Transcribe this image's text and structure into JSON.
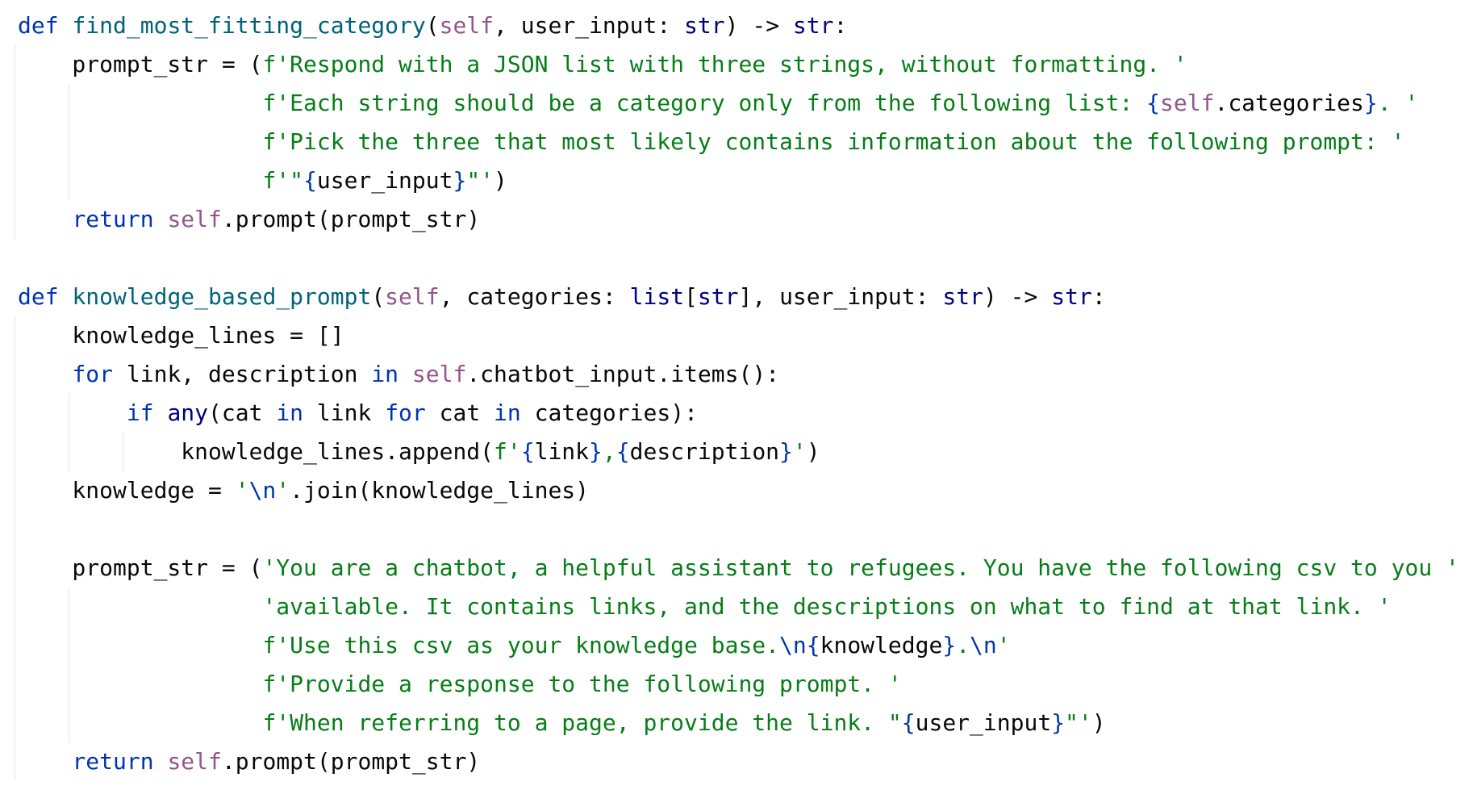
{
  "editor": {
    "colors": {
      "background": "#ffffff",
      "keyword": "#0033b3",
      "function_name": "#00627a",
      "self": "#94558d",
      "builtin": "#000080",
      "string": "#067d17",
      "fstring_brace": "#0037a6",
      "text": "#080808",
      "indent_guide": "#e6e6e6"
    },
    "lines": [
      {
        "tokens": [
          {
            "t": "def",
            "c": "kw"
          },
          {
            "t": " ",
            "c": "plain"
          },
          {
            "t": "find_most_fitting_category",
            "c": "fn"
          },
          {
            "t": "(",
            "c": "plain"
          },
          {
            "t": "self",
            "c": "self"
          },
          {
            "t": ", user_input: ",
            "c": "plain"
          },
          {
            "t": "str",
            "c": "builtin"
          },
          {
            "t": ") -> ",
            "c": "plain"
          },
          {
            "t": "str",
            "c": "builtin"
          },
          {
            "t": ":",
            "c": "plain"
          }
        ]
      },
      {
        "tokens": [
          {
            "t": "    prompt_str = (",
            "c": "plain"
          },
          {
            "t": "f'Respond with a JSON list with three strings, without formatting. '",
            "c": "str"
          }
        ]
      },
      {
        "tokens": [
          {
            "t": "                  ",
            "c": "plain"
          },
          {
            "t": "f'Each string should be a category only from the following list: ",
            "c": "str"
          },
          {
            "t": "{",
            "c": "brace"
          },
          {
            "t": "self",
            "c": "self"
          },
          {
            "t": ".categories",
            "c": "plain"
          },
          {
            "t": "}",
            "c": "brace"
          },
          {
            "t": ". '",
            "c": "str"
          }
        ]
      },
      {
        "tokens": [
          {
            "t": "                  ",
            "c": "plain"
          },
          {
            "t": "f'Pick the three that most likely contains information about the following prompt: '",
            "c": "str"
          }
        ]
      },
      {
        "tokens": [
          {
            "t": "                  ",
            "c": "plain"
          },
          {
            "t": "f'\"",
            "c": "str"
          },
          {
            "t": "{",
            "c": "brace"
          },
          {
            "t": "user_input",
            "c": "plain"
          },
          {
            "t": "}",
            "c": "brace"
          },
          {
            "t": "\"'",
            "c": "str"
          },
          {
            "t": ")",
            "c": "plain"
          }
        ]
      },
      {
        "tokens": [
          {
            "t": "    ",
            "c": "plain"
          },
          {
            "t": "return",
            "c": "kw"
          },
          {
            "t": " ",
            "c": "plain"
          },
          {
            "t": "self",
            "c": "self"
          },
          {
            "t": ".prompt(prompt_str)",
            "c": "plain"
          }
        ]
      },
      {
        "tokens": []
      },
      {
        "tokens": [
          {
            "t": "def",
            "c": "kw"
          },
          {
            "t": " ",
            "c": "plain"
          },
          {
            "t": "knowledge_based_prompt",
            "c": "fn"
          },
          {
            "t": "(",
            "c": "plain"
          },
          {
            "t": "self",
            "c": "self"
          },
          {
            "t": ", categories: ",
            "c": "plain"
          },
          {
            "t": "list",
            "c": "builtin"
          },
          {
            "t": "[",
            "c": "plain"
          },
          {
            "t": "str",
            "c": "builtin"
          },
          {
            "t": "], user_input: ",
            "c": "plain"
          },
          {
            "t": "str",
            "c": "builtin"
          },
          {
            "t": ") -> ",
            "c": "plain"
          },
          {
            "t": "str",
            "c": "builtin"
          },
          {
            "t": ":",
            "c": "plain"
          }
        ]
      },
      {
        "tokens": [
          {
            "t": "    knowledge_lines = []",
            "c": "plain"
          }
        ]
      },
      {
        "tokens": [
          {
            "t": "    ",
            "c": "plain"
          },
          {
            "t": "for",
            "c": "kw"
          },
          {
            "t": " link, description ",
            "c": "plain"
          },
          {
            "t": "in",
            "c": "kw"
          },
          {
            "t": " ",
            "c": "plain"
          },
          {
            "t": "self",
            "c": "self"
          },
          {
            "t": ".chatbot_input.items():",
            "c": "plain"
          }
        ]
      },
      {
        "tokens": [
          {
            "t": "        ",
            "c": "plain"
          },
          {
            "t": "if",
            "c": "kw"
          },
          {
            "t": " ",
            "c": "plain"
          },
          {
            "t": "any",
            "c": "builtin"
          },
          {
            "t": "(cat ",
            "c": "plain"
          },
          {
            "t": "in",
            "c": "kw"
          },
          {
            "t": " link ",
            "c": "plain"
          },
          {
            "t": "for",
            "c": "kw"
          },
          {
            "t": " cat ",
            "c": "plain"
          },
          {
            "t": "in",
            "c": "kw"
          },
          {
            "t": " categories):",
            "c": "plain"
          }
        ]
      },
      {
        "tokens": [
          {
            "t": "            knowledge_lines.append(",
            "c": "plain"
          },
          {
            "t": "f'",
            "c": "str"
          },
          {
            "t": "{",
            "c": "brace"
          },
          {
            "t": "link",
            "c": "plain"
          },
          {
            "t": "}",
            "c": "brace"
          },
          {
            "t": ",",
            "c": "str"
          },
          {
            "t": "{",
            "c": "brace"
          },
          {
            "t": "description",
            "c": "plain"
          },
          {
            "t": "}",
            "c": "brace"
          },
          {
            "t": "'",
            "c": "str"
          },
          {
            "t": ")",
            "c": "plain"
          }
        ]
      },
      {
        "tokens": [
          {
            "t": "    knowledge = ",
            "c": "plain"
          },
          {
            "t": "'",
            "c": "str"
          },
          {
            "t": "\\n",
            "c": "brace"
          },
          {
            "t": "'",
            "c": "str"
          },
          {
            "t": ".join(knowledge_lines)",
            "c": "plain"
          }
        ]
      },
      {
        "tokens": []
      },
      {
        "tokens": [
          {
            "t": "    prompt_str = (",
            "c": "plain"
          },
          {
            "t": "'You are a chatbot, a helpful assistant to refugees. You have the following csv to you '",
            "c": "str"
          }
        ]
      },
      {
        "tokens": [
          {
            "t": "                  ",
            "c": "plain"
          },
          {
            "t": "'available. It contains links, and the descriptions on what to find at that link. '",
            "c": "str"
          }
        ]
      },
      {
        "tokens": [
          {
            "t": "                  ",
            "c": "plain"
          },
          {
            "t": "f'Use this csv as your knowledge base.",
            "c": "str"
          },
          {
            "t": "\\n",
            "c": "brace"
          },
          {
            "t": "{",
            "c": "brace"
          },
          {
            "t": "knowledge",
            "c": "plain"
          },
          {
            "t": "}",
            "c": "brace"
          },
          {
            "t": ".",
            "c": "str"
          },
          {
            "t": "\\n",
            "c": "brace"
          },
          {
            "t": "'",
            "c": "str"
          }
        ]
      },
      {
        "tokens": [
          {
            "t": "                  ",
            "c": "plain"
          },
          {
            "t": "f'Provide a response to the following prompt. '",
            "c": "str"
          }
        ]
      },
      {
        "tokens": [
          {
            "t": "                  ",
            "c": "plain"
          },
          {
            "t": "f'When referring to a page, provide the link. \"",
            "c": "str"
          },
          {
            "t": "{",
            "c": "brace"
          },
          {
            "t": "user_input",
            "c": "plain"
          },
          {
            "t": "}",
            "c": "brace"
          },
          {
            "t": "\"'",
            "c": "str"
          },
          {
            "t": ")",
            "c": "plain"
          }
        ]
      },
      {
        "tokens": [
          {
            "t": "    ",
            "c": "plain"
          },
          {
            "t": "return",
            "c": "kw"
          },
          {
            "t": " ",
            "c": "plain"
          },
          {
            "t": "self",
            "c": "self"
          },
          {
            "t": ".prompt(prompt_str)",
            "c": "plain"
          }
        ]
      }
    ]
  }
}
